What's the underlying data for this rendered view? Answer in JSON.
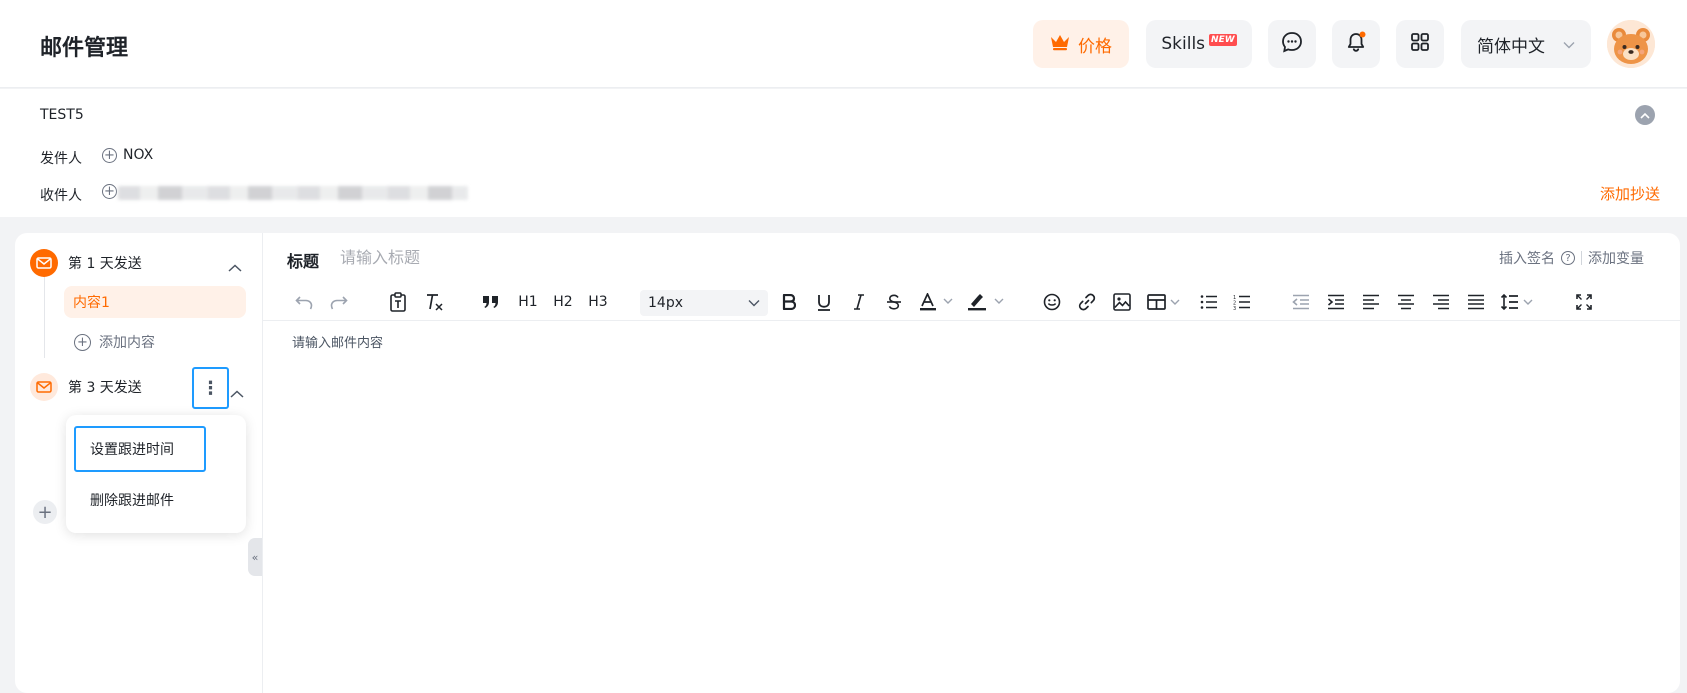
{
  "header": {
    "title": "邮件管理",
    "price_label": "价格",
    "skills_label": "Skills",
    "new_tag": "NEW",
    "language": "简体中文",
    "accent": "#ff6a00",
    "icons": [
      "crown-icon",
      "chat-icon",
      "bell-icon",
      "apps-icon",
      "chevron-down-icon"
    ]
  },
  "info": {
    "subject": "TEST5",
    "sender_label": "发件人",
    "sender_value": "NOX",
    "recipient_label": "收件人",
    "add_cc": "添加抄送"
  },
  "sequence": {
    "step1_label": "第 1 天发送",
    "step1_content": "内容1",
    "add_content": "添加内容",
    "step2_label": "第 3 天发送",
    "menu": {
      "set_time": "设置跟进时间",
      "delete": "删除跟进邮件"
    }
  },
  "editor": {
    "subject_label": "标题",
    "subject_placeholder": "请输入标题",
    "insert_signature": "插入签名",
    "add_variable": "添加变量",
    "h1": "H1",
    "h2": "H2",
    "h3": "H3",
    "font_size": "14px",
    "body_placeholder": "请输入邮件内容"
  }
}
